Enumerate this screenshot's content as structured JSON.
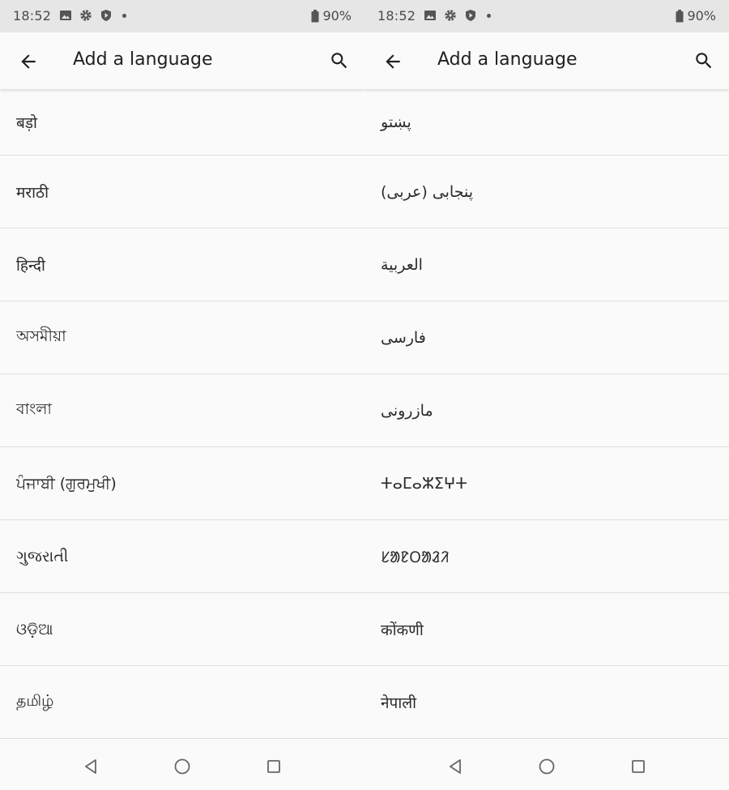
{
  "screens": [
    {
      "status": {
        "time": "18:52",
        "battery": "90%"
      },
      "appbar": {
        "title": "Add a language"
      },
      "languages": [
        "बड़ो",
        "मराठी",
        "हिन्दी",
        "অসমীয়া",
        "বাংলা",
        "ਪੰਜਾਬੀ (ਗੁਰਮੁਖੀ)",
        "ગુજરાતી",
        "ଓଡ଼ିଆ",
        "தமிழ்"
      ]
    },
    {
      "status": {
        "time": "18:52",
        "battery": "90%"
      },
      "appbar": {
        "title": "Add a language"
      },
      "languages": [
        "پښتو",
        "پنجابی (عربی)",
        "العربية",
        "فارسی",
        "مازرونی",
        "ⵜⴰⵎⴰⵣⵉⵖⵜ",
        "ᱥᱟᱱᱛᱟᱲᱤ",
        "कोंकणी",
        "नेपाली"
      ]
    }
  ],
  "icons": {
    "status": [
      "image-icon",
      "gear-icon",
      "shield-icon",
      "dot-icon",
      "battery-icon"
    ],
    "appbar": [
      "back-arrow-icon",
      "search-icon"
    ],
    "nav": [
      "back-triangle-icon",
      "home-circle-icon",
      "recents-square-icon"
    ]
  }
}
